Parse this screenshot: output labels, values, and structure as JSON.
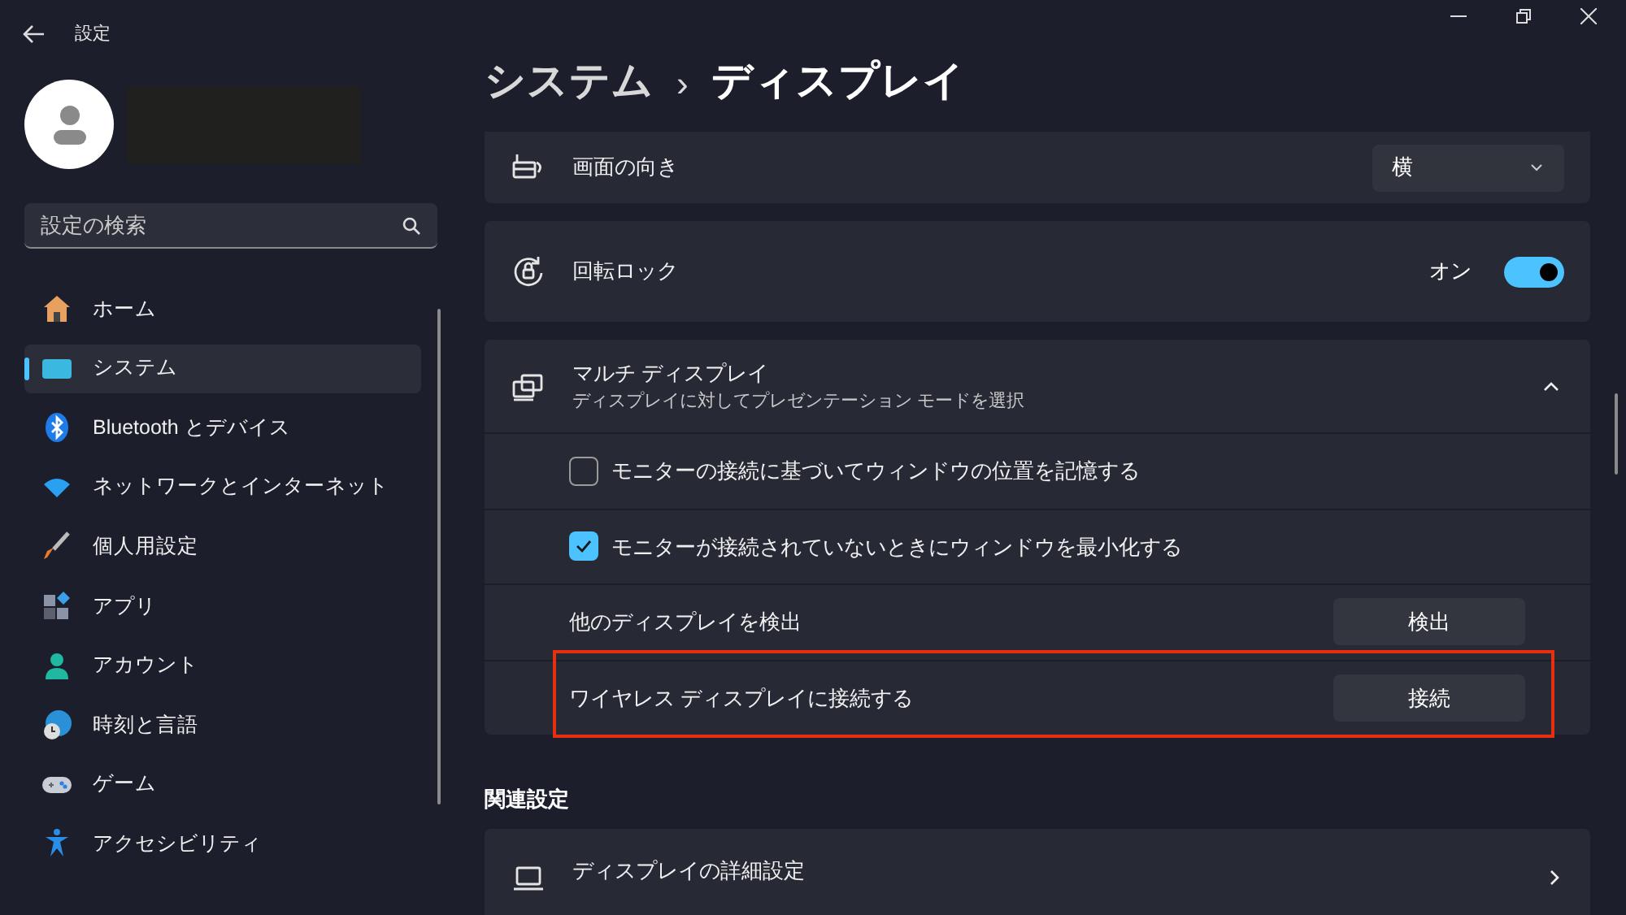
{
  "window": {
    "title": "設定"
  },
  "search": {
    "placeholder": "設定の検索"
  },
  "sidebar": {
    "items": [
      {
        "label": "ホーム",
        "selected": false
      },
      {
        "label": "システム",
        "selected": true
      },
      {
        "label": "Bluetooth とデバイス",
        "selected": false
      },
      {
        "label": "ネットワークとインターネット",
        "selected": false
      },
      {
        "label": "個人用設定",
        "selected": false
      },
      {
        "label": "アプリ",
        "selected": false
      },
      {
        "label": "アカウント",
        "selected": false
      },
      {
        "label": "時刻と言語",
        "selected": false
      },
      {
        "label": "ゲーム",
        "selected": false
      },
      {
        "label": "アクセシビリティ",
        "selected": false
      }
    ]
  },
  "breadcrumb": {
    "parent": "システム",
    "separator": "›",
    "current": "ディスプレイ"
  },
  "settings": [
    {
      "kind": "dropdown",
      "label": "画面の向き",
      "value": "横"
    },
    {
      "kind": "toggle",
      "label": "回転ロック",
      "state_label": "オン",
      "on": true
    },
    {
      "kind": "group",
      "label": "マルチ ディスプレイ",
      "description": "ディスプレイに対してプレゼンテーション モードを選択",
      "expanded": true,
      "children": [
        {
          "kind": "checkbox",
          "label": "モニターの接続に基づいてウィンドウの位置を記憶する",
          "checked": false,
          "highlighted": false
        },
        {
          "kind": "checkbox",
          "label": "モニターが接続されていないときにウィンドウを最小化する",
          "checked": true,
          "highlighted": false
        },
        {
          "kind": "button",
          "label": "他のディスプレイを検出",
          "button": "検出",
          "highlighted": false
        },
        {
          "kind": "button",
          "label": "ワイヤレス ディスプレイに接続する",
          "button": "接続",
          "highlighted": true
        }
      ]
    }
  ],
  "related": {
    "heading": "関連設定",
    "items": [
      {
        "label": "ディスプレイの詳細設定"
      }
    ]
  }
}
